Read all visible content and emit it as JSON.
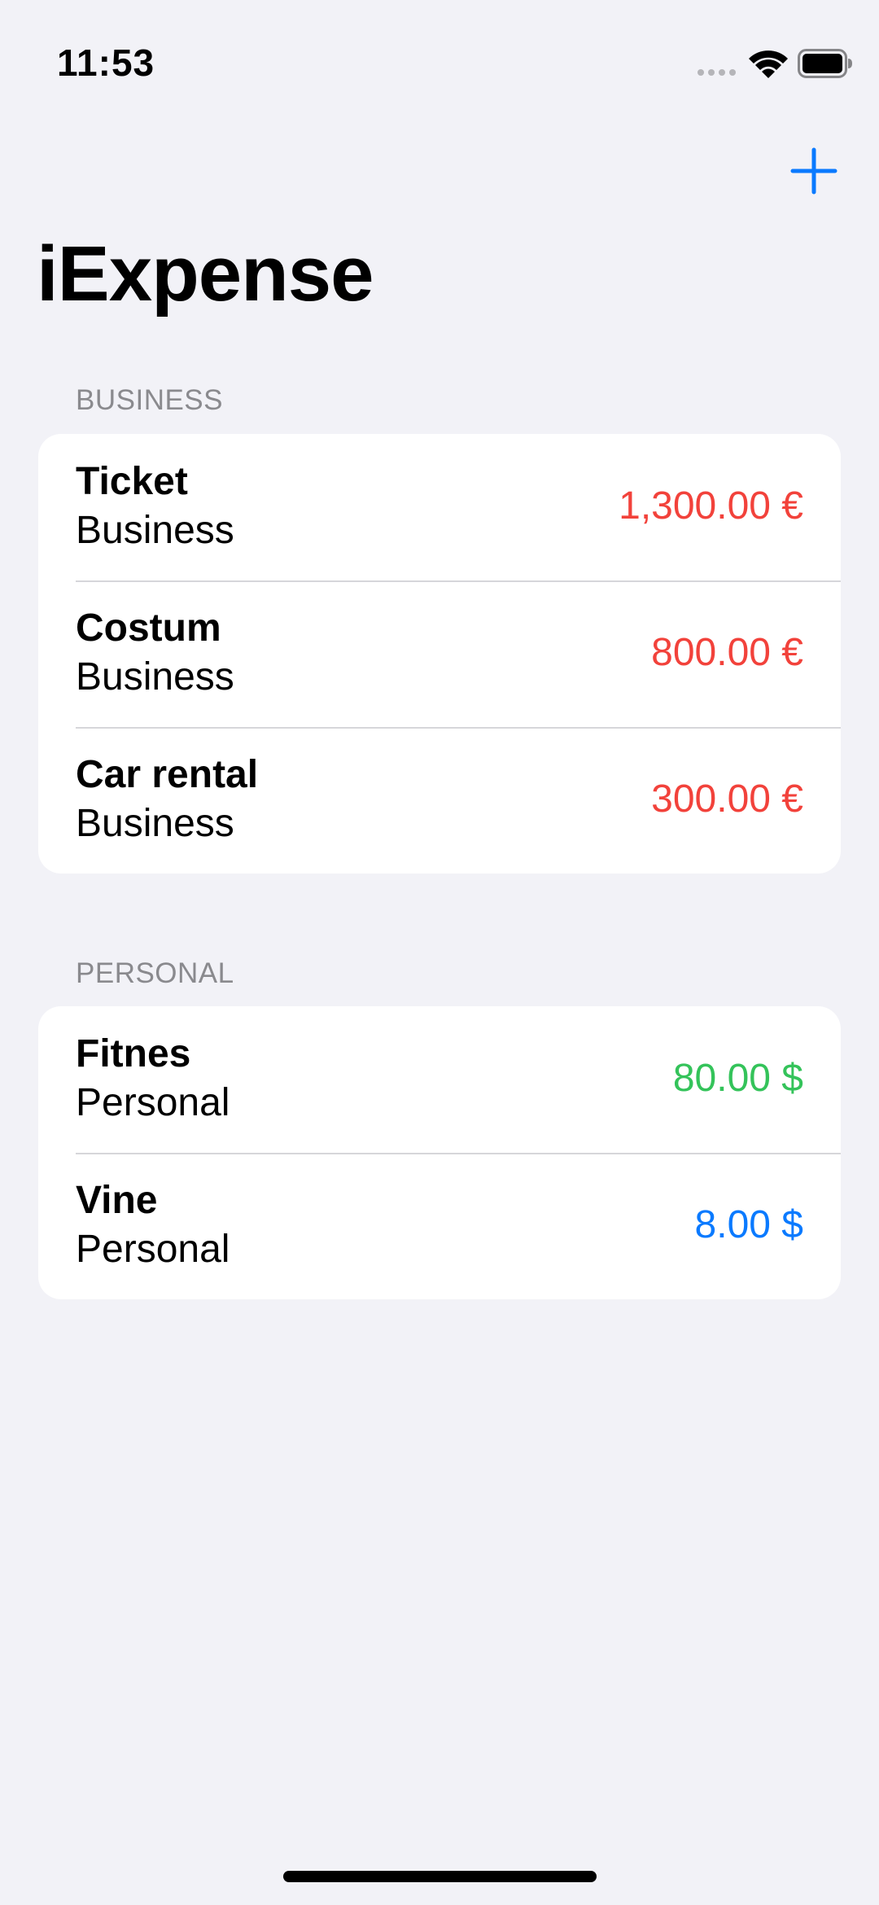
{
  "status_bar": {
    "time": "11:53",
    "icons": [
      "signal-icon",
      "wifi-icon",
      "battery-icon"
    ]
  },
  "nav": {
    "title": "iExpense",
    "add_icon": "plus-icon",
    "accent_color": "#0a7aff"
  },
  "sections": [
    {
      "header": "BUSINESS",
      "items": [
        {
          "name": "Ticket",
          "type": "Business",
          "amount": "1,300.00 €",
          "color": "#f2423b"
        },
        {
          "name": "Costum",
          "type": "Business",
          "amount": "800.00 €",
          "color": "#f2423b"
        },
        {
          "name": "Car rental",
          "type": "Business",
          "amount": "300.00 €",
          "color": "#f2423b"
        }
      ]
    },
    {
      "header": "PERSONAL",
      "items": [
        {
          "name": "Fitnes",
          "type": "Personal",
          "amount": "80.00 $",
          "color": "#34c35a"
        },
        {
          "name": "Vine",
          "type": "Personal",
          "amount": "8.00 $",
          "color": "#0a7aff"
        }
      ]
    }
  ]
}
